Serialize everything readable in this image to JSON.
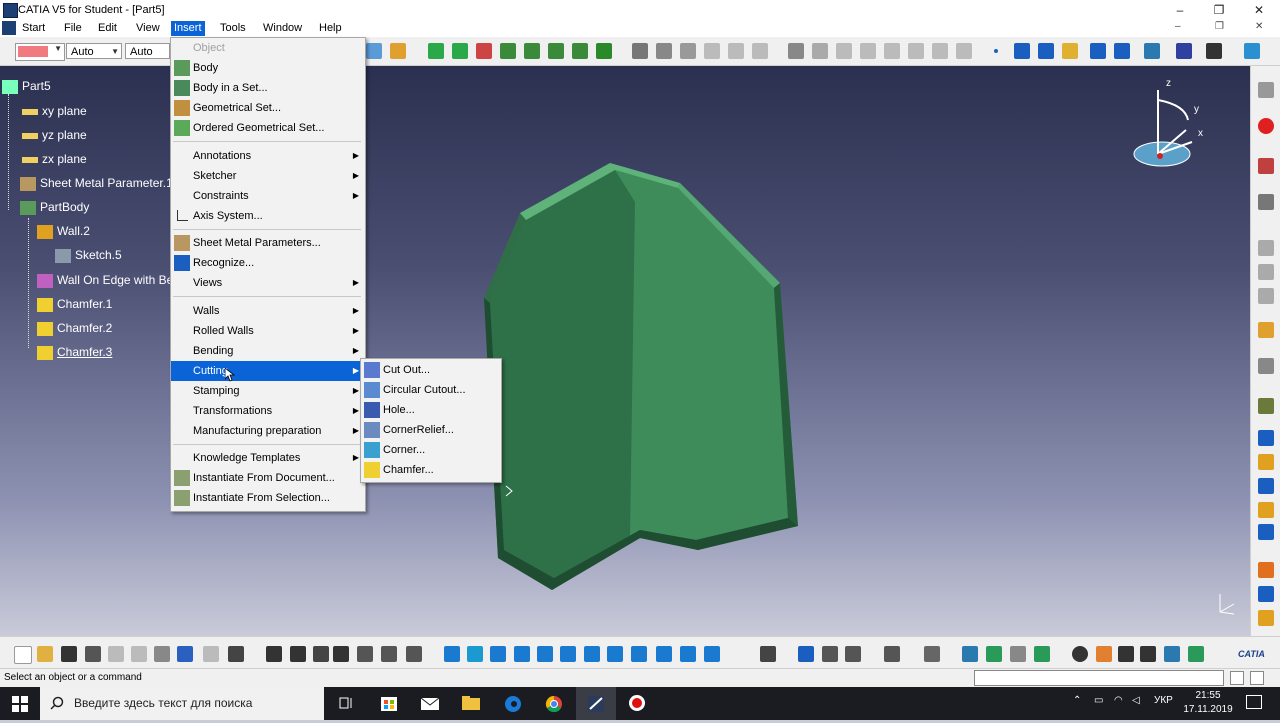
{
  "window": {
    "title": "CATIA V5 for Student - [Part5]",
    "minimize": "–",
    "restore": "❐",
    "close": "✕"
  },
  "menubar": [
    "Start",
    "File",
    "Edit",
    "View",
    "Insert",
    "Tools",
    "Window",
    "Help"
  ],
  "toolbar": {
    "linetype_value": "Auto",
    "thickness_value": "Auto",
    "color_swatch": "#f07a80"
  },
  "tree": {
    "root": "Part5",
    "nodes": [
      {
        "label": "xy plane"
      },
      {
        "label": "yz plane"
      },
      {
        "label": "zx plane"
      },
      {
        "label": "Sheet Metal Parameter.1"
      },
      {
        "label": "PartBody"
      },
      {
        "label": "Wall.2"
      },
      {
        "label": "Sketch.5"
      },
      {
        "label": "Wall On Edge with Be"
      },
      {
        "label": "Chamfer.1"
      },
      {
        "label": "Chamfer.2"
      },
      {
        "label": "Chamfer.3"
      }
    ]
  },
  "compass": {
    "z": "z",
    "y": "y",
    "x": "x"
  },
  "insert_menu": {
    "items": [
      {
        "label": "Object",
        "icon": "none"
      },
      {
        "label": "Body",
        "icon": "body-icon"
      },
      {
        "label": "Body in a Set...",
        "icon": "body-in-set-icon"
      },
      {
        "label": "Geometrical Set...",
        "icon": "geometrical-set-icon"
      },
      {
        "label": "Ordered Geometrical Set...",
        "icon": "ordered-geometrical-set-icon"
      },
      {
        "label": "Annotations"
      },
      {
        "label": "Sketcher"
      },
      {
        "label": "Constraints"
      },
      {
        "label": "Axis System...",
        "icon": "axis-system-icon"
      },
      {
        "label": "Sheet Metal Parameters...",
        "icon": "sheet-metal-parameters-icon"
      },
      {
        "label": "Recognize...",
        "icon": "recognize-icon"
      },
      {
        "label": "Views"
      },
      {
        "label": "Walls"
      },
      {
        "label": "Rolled Walls"
      },
      {
        "label": "Bending"
      },
      {
        "label": "Cutting"
      },
      {
        "label": "Stamping"
      },
      {
        "label": "Transformations"
      },
      {
        "label": "Manufacturing preparation"
      },
      {
        "label": "Knowledge Templates"
      },
      {
        "label": "Instantiate From Document...",
        "icon": "instantiate-document-icon"
      },
      {
        "label": "Instantiate From Selection...",
        "icon": "instantiate-selection-icon"
      }
    ]
  },
  "cutting_submenu": {
    "items": [
      {
        "label": "Cut Out...",
        "icon": "cut-out-icon"
      },
      {
        "label": "Circular Cutout...",
        "icon": "circular-cutout-icon"
      },
      {
        "label": "Hole...",
        "icon": "hole-icon"
      },
      {
        "label": "CornerRelief...",
        "icon": "corner-relief-icon"
      },
      {
        "label": "Corner...",
        "icon": "corner-icon"
      },
      {
        "label": "Chamfer...",
        "icon": "chamfer-icon"
      }
    ]
  },
  "status": {
    "message": "Select an object or a command"
  },
  "taskbar": {
    "search_placeholder": "Введите здесь текст для поиска",
    "language": "УКР",
    "time": "21:55",
    "date": "17.11.2019"
  },
  "catia_logo": "CATIA"
}
